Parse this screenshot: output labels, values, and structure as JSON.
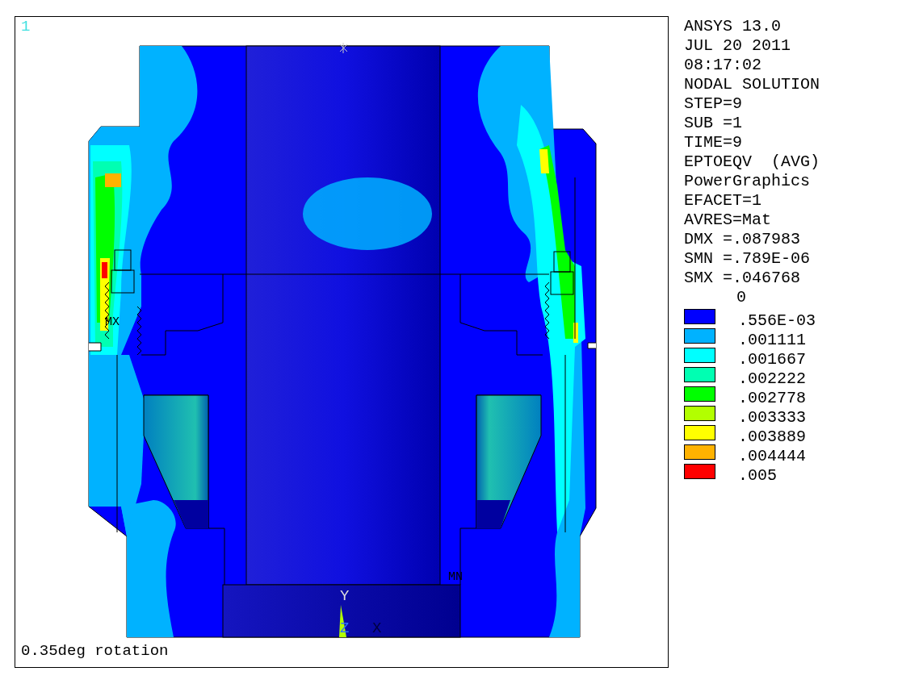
{
  "plot": {
    "window_number": "1",
    "caption": "0.35deg rotation",
    "max_marker": "MX",
    "min_marker": "MN",
    "axes": {
      "y": "Y",
      "z": "Z",
      "x": "X"
    }
  },
  "info": [
    "ANSYS 13.0",
    "JUL 20 2011",
    "08:17:02",
    "NODAL SOLUTION",
    "STEP=9",
    "SUB =1",
    "TIME=9",
    "EPTOEQV  (AVG)",
    "PowerGraphics",
    "EFACET=1",
    "AVRES=Mat",
    "DMX =.087983",
    "SMN =.789E-06",
    "SMX =.046768"
  ],
  "legend": {
    "first_value": "0",
    "bands": [
      {
        "color": "#0000ff",
        "value": ".556E-03"
      },
      {
        "color": "#00b2ff",
        "value": ".001111"
      },
      {
        "color": "#00ffff",
        "value": ".001667"
      },
      {
        "color": "#00ffb2",
        "value": ".002222"
      },
      {
        "color": "#00ff00",
        "value": ".002778"
      },
      {
        "color": "#b2ff00",
        "value": ".003333"
      },
      {
        "color": "#ffff00",
        "value": ".003889"
      },
      {
        "color": "#ffb200",
        "value": ".004444"
      },
      {
        "color": "#ff0000",
        "value": ".005"
      }
    ]
  }
}
